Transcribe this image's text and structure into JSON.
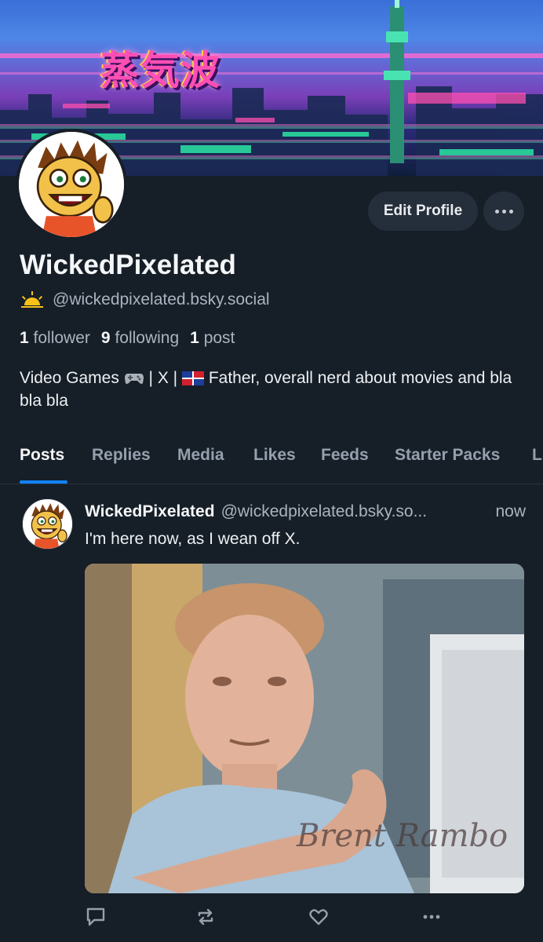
{
  "banner": {
    "title": "蒸気波"
  },
  "profile": {
    "display_name": "WickedPixelated",
    "handle": "@wickedpixelated.bsky.social",
    "stats": {
      "followers": "1",
      "followers_label": "follower",
      "following": "9",
      "following_label": "following",
      "posts": "1",
      "posts_label": "post"
    },
    "bio_part1": "Video Games",
    "bio_part2": "| X |",
    "bio_part3": "Father, overall nerd about movies and bla bla bla"
  },
  "actions": {
    "edit_label": "Edit Profile"
  },
  "tabs": [
    {
      "label": "Posts",
      "active": true
    },
    {
      "label": "Replies"
    },
    {
      "label": "Media"
    },
    {
      "label": "Likes"
    },
    {
      "label": "Feeds"
    },
    {
      "label": "Starter Packs"
    },
    {
      "label": "L"
    }
  ],
  "post": {
    "author": "WickedPixelated",
    "handle": "@wickedpixelated.bsky.so...",
    "time": "now",
    "text": "I'm here now, as I wean off X.",
    "media_signature": "Brent Rambo"
  },
  "colors": {
    "accent": "#1083fe",
    "background": "#161e27",
    "button": "#252f3b"
  },
  "icons": [
    "sun-icon",
    "controller-icon",
    "dominican-flag-icon",
    "reply-icon",
    "repost-icon",
    "like-icon",
    "more-icon"
  ]
}
